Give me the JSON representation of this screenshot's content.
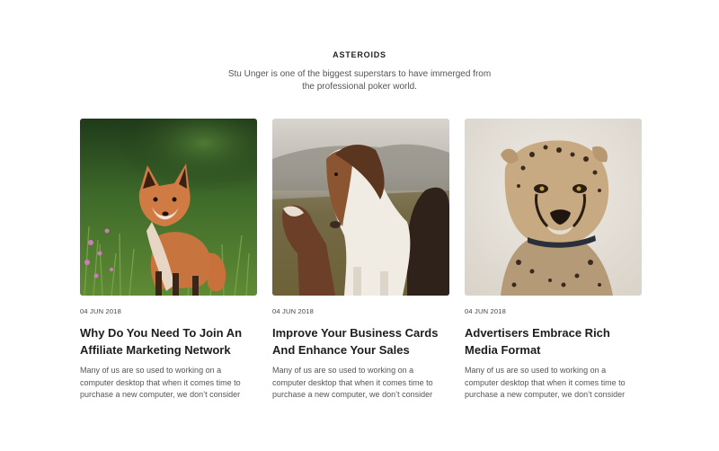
{
  "section": {
    "eyebrow": "ASTEROIDS",
    "subtitle": "Stu Unger is one of the biggest superstars to have immerged from the professional poker world."
  },
  "cards": [
    {
      "image_alt": "fox-in-meadow",
      "date": "04 JUN 2018",
      "title": "Why Do You Need To Join An Affiliate Marketing Network",
      "excerpt": "Many of us are so used to working on a computer desktop that when it comes time to purchase a new computer, we don’t consider"
    },
    {
      "image_alt": "horses-in-field",
      "date": "04 JUN 2018",
      "title": "Improve Your Business Cards And Enhance Your Sales",
      "excerpt": "Many of us are so used to working on a computer desktop that when it comes time to purchase a new computer, we don’t consider"
    },
    {
      "image_alt": "cheetah-cub-portrait",
      "date": "04 JUN 2018",
      "title": "Advertisers Embrace Rich Media Format",
      "excerpt": "Many of us are so used to working on a computer desktop that when it comes time to purchase a new computer, we don’t consider"
    }
  ]
}
